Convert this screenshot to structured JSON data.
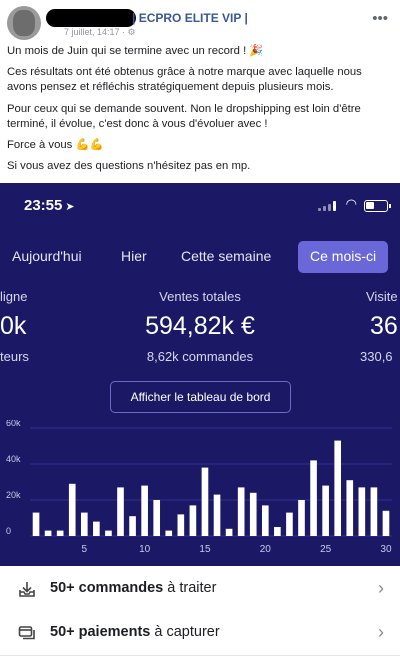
{
  "post": {
    "group_name": "| ECPRO ELITE VIP |",
    "meta": "7 juillet, 14:17 · ⚙",
    "more_label": "•••",
    "paragraphs": [
      "Un mois de Juin qui se termine avec un record ! 🎉",
      "Ces résultats ont été obtenus grâce à notre marque avec laquelle nous avons pensez et réfléchis stratégiquement depuis plusieurs mois.",
      "Pour ceux qui se demande souvent. Non le dropshipping est loin d'être terminé, il évolue, c'est donc à vous d'évoluer avec !",
      "Force à vous 💪💪",
      "Si vous avez des questions n'hésitez pas en mp."
    ]
  },
  "phone": {
    "time": "23:55",
    "time_arrow": "➤",
    "tabs": [
      "Aujourd'hui",
      "Hier",
      "Cette semaine",
      "Ce mois-ci"
    ],
    "active_tab_index": 3,
    "stats": {
      "left": {
        "label": "ligne",
        "big": "0k",
        "small": "teurs"
      },
      "center": {
        "label": "Ventes totales",
        "big": "594,82k €",
        "small": "8,62k commandes"
      },
      "right": {
        "label": "Visite",
        "big": "36",
        "small": "330,6"
      }
    },
    "dashboard_button": "Afficher le tableau de bord",
    "actions": [
      {
        "bold": "50+ commandes",
        "rest": " à traiter",
        "icon": "inbox-download-icon"
      },
      {
        "bold": "50+ paiements",
        "rest": " à capturer",
        "icon": "cards-icon"
      }
    ]
  },
  "chart_data": {
    "type": "bar",
    "x": [
      1,
      2,
      3,
      4,
      5,
      6,
      7,
      8,
      9,
      10,
      11,
      12,
      13,
      14,
      15,
      16,
      17,
      18,
      19,
      20,
      21,
      22,
      23,
      24,
      25,
      26,
      27,
      28,
      29,
      30
    ],
    "values": [
      13,
      3,
      3,
      29,
      13,
      8,
      3,
      27,
      11,
      28,
      20,
      3,
      12,
      17,
      38,
      23,
      4,
      27,
      24,
      17,
      5,
      13,
      20,
      42,
      28,
      53,
      31,
      27,
      27,
      14
    ],
    "y_ticks": [
      "0",
      "20k",
      "40k",
      "60k"
    ],
    "x_ticks": [
      "5",
      "10",
      "15",
      "20",
      "25",
      "30"
    ],
    "ylim": [
      0,
      60
    ],
    "bar_color": "#ffffff",
    "grid": true
  }
}
